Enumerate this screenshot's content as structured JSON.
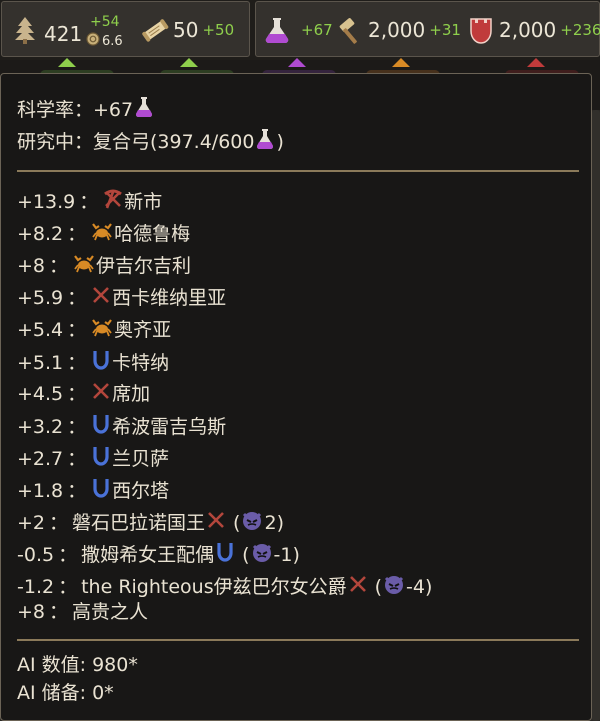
{
  "topbar": {
    "wood": {
      "value": "421",
      "delta": "+54",
      "sub_value": "6.6",
      "icon": "tree-icon",
      "sub_icon": "coin-icon"
    },
    "scroll": {
      "value": "50",
      "delta": "+50",
      "icon": "scroll-icon"
    },
    "science": {
      "delta": "+67",
      "icon": "flask-icon"
    },
    "influence": {
      "value": "2,000",
      "delta": "+31",
      "icon": "hammer-icon"
    },
    "military": {
      "value": "2,000",
      "delta": "+236",
      "icon": "shield-icon"
    }
  },
  "colors": {
    "delta_green": "#8fcf4c",
    "text": "#e9e2d2",
    "flask_purple": "#b04bd1",
    "pick_red": "#b3463c",
    "crab_orange": "#d88a25",
    "horseshoe_blue": "#4a72d8",
    "demon_purple": "#6a5ca8"
  },
  "tooltip": {
    "science_rate_label": "科学率：+67",
    "researching_label": "研究中：复合弓(397.4/600",
    "researching_suffix": ")",
    "contributions": [
      {
        "value": "+13.9",
        "icon": "pickaxe-icon",
        "name": "新市"
      },
      {
        "value": "+8.2",
        "icon": "crab-icon",
        "name": "哈德鲁梅"
      },
      {
        "value": "+8",
        "icon": "crab-icon",
        "name": "伊吉尔吉利"
      },
      {
        "value": "+5.9",
        "icon": "pickaxe-icon",
        "name": "西卡维纳里亚"
      },
      {
        "value": "+5.4",
        "icon": "crab-icon",
        "name": "奥齐亚"
      },
      {
        "value": "+5.1",
        "icon": "horseshoe-icon",
        "name": "卡特纳"
      },
      {
        "value": "+4.5",
        "icon": "pickaxe-icon",
        "name": "席加"
      },
      {
        "value": "+3.2",
        "icon": "horseshoe-icon",
        "name": "希波雷吉乌斯"
      },
      {
        "value": "+2.7",
        "icon": "horseshoe-icon",
        "name": "兰贝萨"
      },
      {
        "value": "+1.8",
        "icon": "horseshoe-icon",
        "name": "西尔塔"
      }
    ],
    "characters": [
      {
        "value": "+2",
        "name": "磐石巴拉诺国王",
        "icon": "pickaxe-icon",
        "opinion": "2"
      },
      {
        "value": "-0.5",
        "name": "撒姆希女王配偶",
        "icon": "horseshoe-icon",
        "opinion": "-1"
      },
      {
        "value": "-1.2",
        "name": "the Righteous伊兹巴尔女公爵",
        "icon": "pickaxe-icon",
        "opinion": "-4"
      }
    ],
    "noble": {
      "value": "+8",
      "name": "高贵之人"
    },
    "colon": "：",
    "paren_open": "(",
    "paren_close": ")",
    "ai_value": "AI 数值: 980*",
    "ai_reserve": "AI 储备: 0*"
  }
}
